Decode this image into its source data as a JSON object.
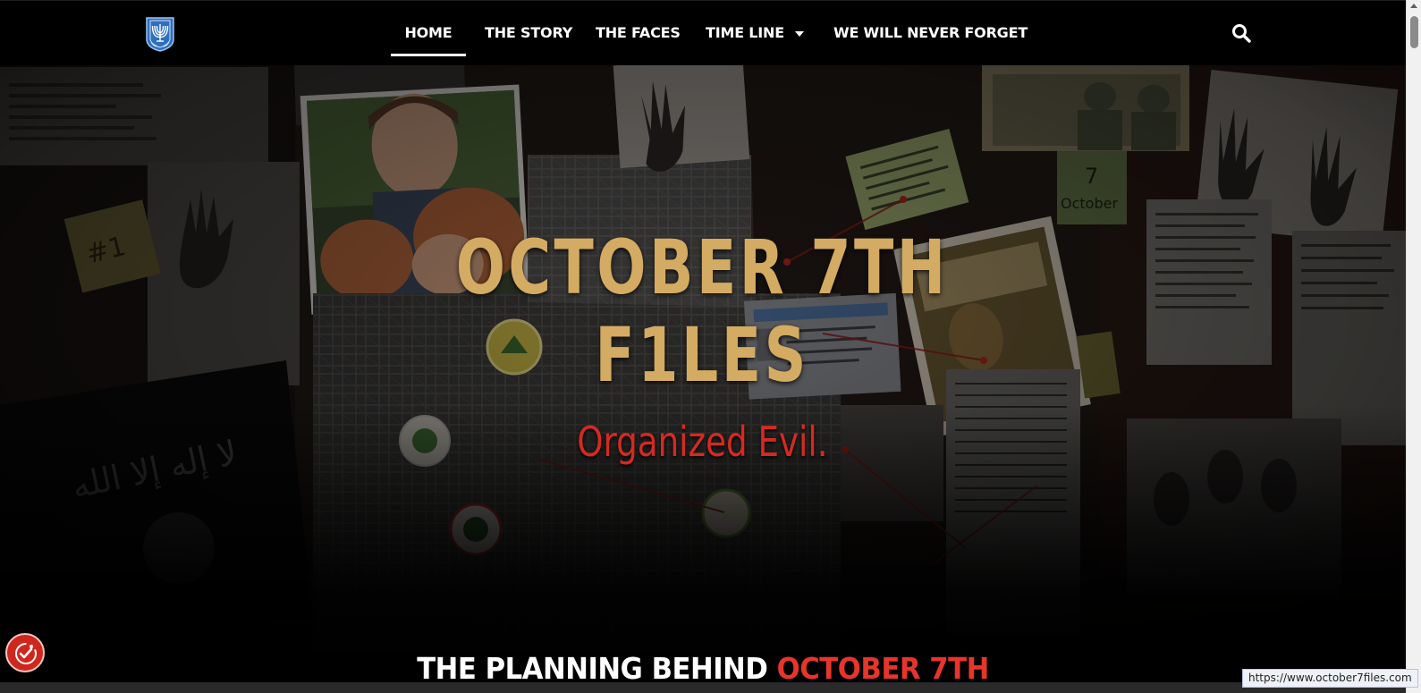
{
  "nav": {
    "logo_icon": "menorah-emblem-icon",
    "items": [
      {
        "label": "HOME",
        "active": true
      },
      {
        "label": "THE STORY"
      },
      {
        "label": "THE FACES"
      },
      {
        "label": "TIME LINE",
        "has_dropdown": true
      },
      {
        "label": "WE WILL NEVER FORGET"
      }
    ],
    "search_icon": "search-icon"
  },
  "hero": {
    "title_line1": "OCTOBER 7TH",
    "title_line2": "F1LES",
    "tagline": "Organized Evil.",
    "background": "evidence-board-collage"
  },
  "section": {
    "heading_white": "THE PLANNING BEHIND ",
    "heading_accent": "OCTOBER 7TH"
  },
  "accessibility_button": {
    "icon": "accessibility-icon"
  },
  "status_url": "https://www.october7files.com",
  "colors": {
    "nav_bg": "#000000",
    "title_gold": "#d4ab63",
    "tagline_red": "#d42a22",
    "heading_accent_red": "#e6352b",
    "accessibility_red": "#d0271d"
  }
}
